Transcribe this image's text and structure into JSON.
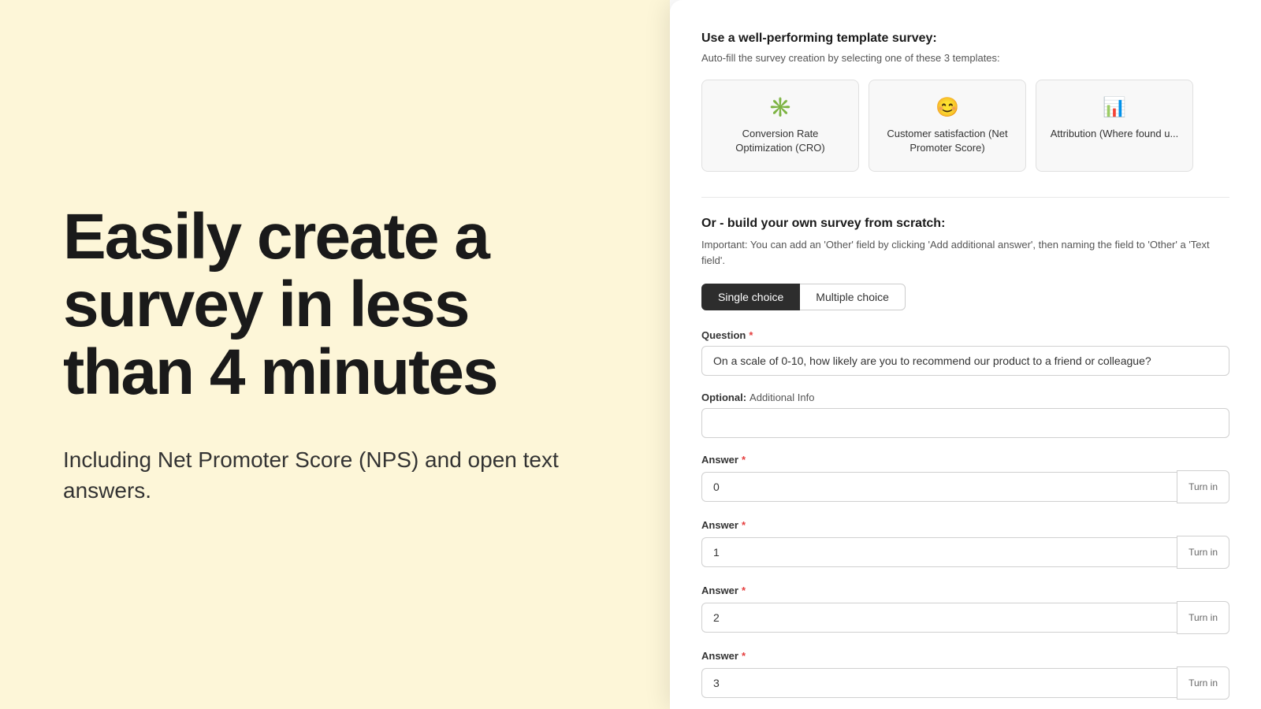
{
  "left": {
    "hero_title": "Easily create a survey in less than 4 minutes",
    "hero_subtitle": "Including Net Promoter Score (NPS) and open text answers."
  },
  "right": {
    "template_section_title": "Use a well-performing template survey:",
    "template_section_desc": "Auto-fill the survey creation by selecting one of these 3 templates:",
    "templates": [
      {
        "icon": "✳️",
        "label": "Conversion Rate Optimization (CRO)"
      },
      {
        "icon": "😊",
        "label": "Customer satisfaction (Net Promoter Score)"
      },
      {
        "icon": "📊",
        "label": "Attribution (Where found u..."
      }
    ],
    "build_title": "Or - build your own survey from scratch:",
    "build_note": "Important: You can add an 'Other' field by clicking 'Add additional answer', then naming the field to 'Other' a 'Text field'.",
    "toggle": {
      "single_choice_label": "Single choice",
      "multiple_choice_label": "Multiple choice"
    },
    "question_label": "Question",
    "question_value": "On a scale of 0-10, how likely are you to recommend our product to a friend or colleague?",
    "optional_label": "Optional:",
    "optional_placeholder": "Additional Info",
    "answers": [
      {
        "label": "Answer",
        "value": "0",
        "turn_in": "Turn in"
      },
      {
        "label": "Answer",
        "value": "1",
        "turn_in": "Turn in"
      },
      {
        "label": "Answer",
        "value": "2",
        "turn_in": "Turn in"
      },
      {
        "label": "Answer",
        "value": "3",
        "turn_in": "Turn in"
      }
    ]
  }
}
